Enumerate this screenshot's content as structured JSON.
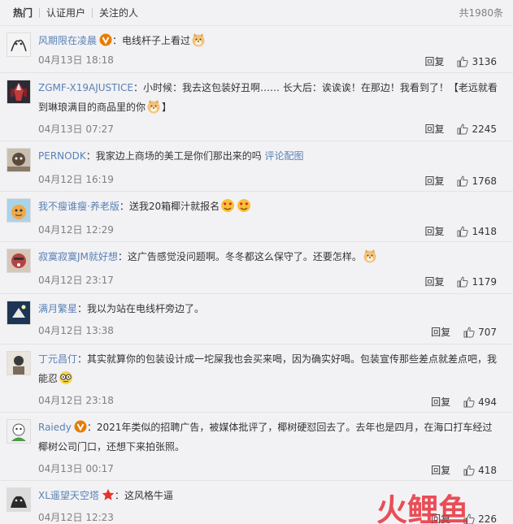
{
  "tabs": {
    "hot": "热门",
    "verified": "认证用户",
    "following": "关注的人",
    "total": "共1980条"
  },
  "reply_label": "回复",
  "comments": [
    {
      "user": "风期限在凌晨",
      "badge": "verified",
      "text": "电线杆子上看过",
      "emoji_after": "doge",
      "time": "04月13日 18:18",
      "likes": "3136"
    },
    {
      "user": "ZGMF-X19AJUSTICE",
      "text": "小时候：我去这包装好丑啊…… 长大后：诶诶诶！在那边！我看到了！【老远就看到琳琅满目的商品里的你",
      "emoji_after": "doge",
      "text_tail": "】",
      "time": "04月13日 07:27",
      "likes": "2245"
    },
    {
      "user": "PERNODK",
      "text": "我家边上商场的美工是你们那出来的吗",
      "link": "评论配图",
      "time": "04月12日 16:19",
      "likes": "1768"
    },
    {
      "user": "我不瘦谁瘦·养老版",
      "text": "送我20箱椰汁就报名",
      "emoji_after": "heart-eyes x2",
      "time": "04月12日 12:29",
      "likes": "1418"
    },
    {
      "user": "寂寞寂寞JM就好想",
      "text": "这广告感觉没问题啊。冬冬都这么保守了。还要怎样。",
      "emoji_after": "doge",
      "time": "04月12日 23:17",
      "likes": "1179"
    },
    {
      "user": "满月繁星",
      "text": "我以为站在电线杆旁边了。",
      "time": "04月12日 13:38",
      "likes": "707"
    },
    {
      "user": "丁元昌仃",
      "text": "其实就算你的包装设计成一坨屎我也会买来喝，因为确实好喝。包装宣传那些差点就差点吧，我能忍",
      "emoji_after": "glasses",
      "time": "04月12日 23:18",
      "likes": "494"
    },
    {
      "user": "Raiedy",
      "badge": "verified",
      "text": "2021年类似的招聘广告，被媒体批评了，椰树硬怼回去了。去年也是四月，在海口打车经过椰树公司门口，还想下来拍张照。",
      "time": "04月13日 00:17",
      "likes": "418"
    },
    {
      "user": "XL遥望天空塔",
      "badge": "star",
      "text": "这风格牛逼",
      "time": "04月12日 12:23",
      "likes": "226"
    }
  ],
  "watermark": "火鲤鱼",
  "colors": {
    "username": "#5a82b4",
    "time": "#808080",
    "background": "#f2f2f5",
    "badge": "#e87b00",
    "watermark": "#e8303a"
  }
}
